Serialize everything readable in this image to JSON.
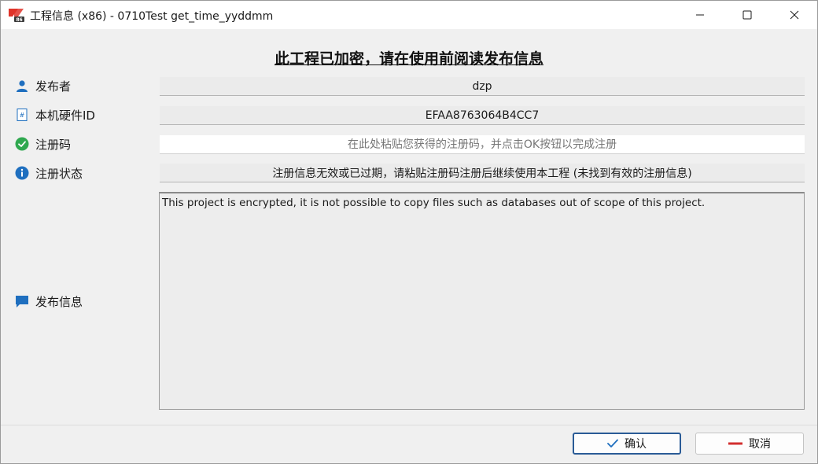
{
  "window": {
    "title": "工程信息 (x86) - 0710Test get_time_yyddmm"
  },
  "heading": "此工程已加密，请在使用前阅读发布信息",
  "fields": {
    "publisher": {
      "label": "发布者",
      "value": "dzp"
    },
    "hardware_id": {
      "label": "本机硬件ID",
      "value": "EFAA8763064B4CC7"
    },
    "reg_code": {
      "label": "注册码",
      "placeholder": "在此处粘贴您获得的注册码，并点击OK按钮以完成注册",
      "value": ""
    },
    "reg_status": {
      "label": "注册状态",
      "value": "注册信息无效或已过期，请粘贴注册码注册后继续使用本工程 (未找到有效的注册信息)"
    },
    "release_info": {
      "label": "发布信息",
      "value": "This project is encrypted, it is not possible to copy files such as databases out of scope of this project."
    }
  },
  "buttons": {
    "ok": "确认",
    "cancel": "取消"
  },
  "icons": {
    "publisher": "user-icon",
    "hardware_id": "id-card-icon",
    "reg_code": "check-circle-icon",
    "reg_status": "info-circle-icon",
    "release_info": "chat-bubble-icon"
  },
  "colors": {
    "accent_blue": "#1f6fbf",
    "success_green": "#2fa84f",
    "cancel_red": "#d32f2f",
    "ok_border": "#2a5b96"
  }
}
